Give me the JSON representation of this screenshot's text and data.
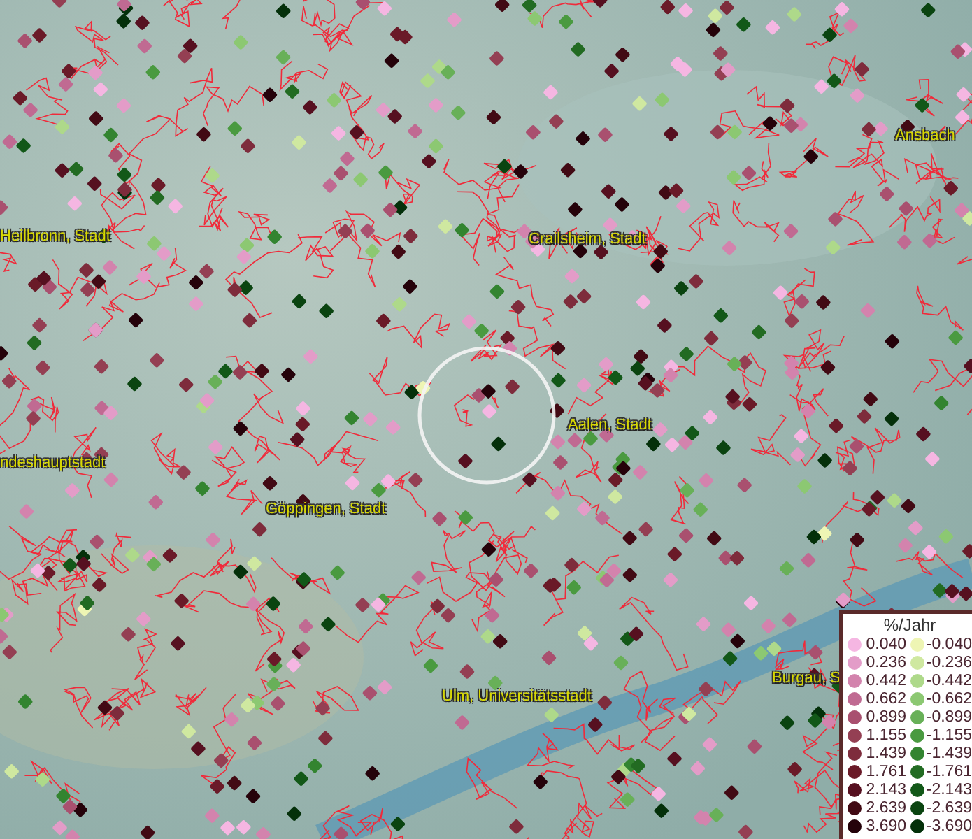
{
  "map": {
    "places": [
      "Heilbronn, Stadt",
      "Crailsheim, Stadt",
      "Ansbach",
      "ndeshauptstadt",
      "Aalen, Stadt",
      "Göppingen, Stadt",
      "Ulm, Universitätsstadt",
      "Burgau, S"
    ]
  },
  "legend": {
    "title": "%/Jahr",
    "positive": [
      {
        "label": "0.040",
        "color": "#f5b6e2"
      },
      {
        "label": "0.236",
        "color": "#e39cc8"
      },
      {
        "label": "0.442",
        "color": "#d383ad"
      },
      {
        "label": "0.662",
        "color": "#c06a92"
      },
      {
        "label": "0.899",
        "color": "#a9506f"
      },
      {
        "label": "1.155",
        "color": "#943f53"
      },
      {
        "label": "1.439",
        "color": "#7e2c3c"
      },
      {
        "label": "1.761",
        "color": "#6a1a28"
      },
      {
        "label": "2.143",
        "color": "#561020"
      },
      {
        "label": "2.639",
        "color": "#420a14"
      },
      {
        "label": "3.690",
        "color": "#25020a"
      }
    ],
    "negative": [
      {
        "label": "-0.040",
        "color": "#eef5b4"
      },
      {
        "label": "-0.236",
        "color": "#cfe8a0"
      },
      {
        "label": "-0.442",
        "color": "#aed98a"
      },
      {
        "label": "-0.662",
        "color": "#8cc872"
      },
      {
        "label": "-0.899",
        "color": "#68b058"
      },
      {
        "label": "-1.155",
        "color": "#4a9a40"
      },
      {
        "label": "-1.439",
        "color": "#338430"
      },
      {
        "label": "-1.761",
        "color": "#226b22"
      },
      {
        "label": "-2.143",
        "color": "#125818"
      },
      {
        "label": "-2.639",
        "color": "#0a4410"
      },
      {
        "label": "-3.690",
        "color": "#04300a"
      }
    ]
  }
}
